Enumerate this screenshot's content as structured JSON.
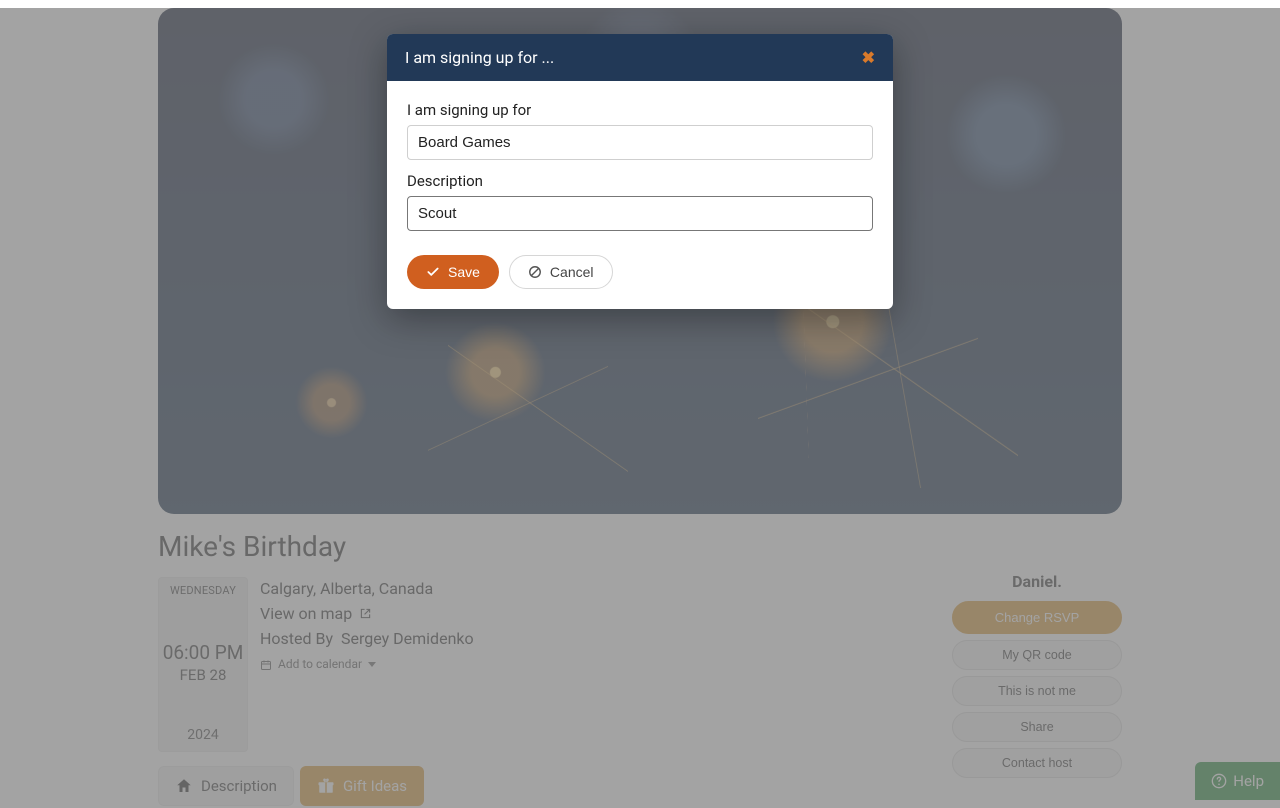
{
  "modal": {
    "title": "I am signing up for ...",
    "field1_label": "I am signing up for",
    "field1_value": "Board Games",
    "field2_label": "Description",
    "field2_value": "Scout",
    "save_label": "Save",
    "cancel_label": "Cancel"
  },
  "event": {
    "title": "Mike's Birthday",
    "weekday": "WEDNESDAY",
    "time": "06:00 PM",
    "monthday": "FEB 28",
    "year": "2024",
    "location": "Calgary, Alberta, Canada",
    "view_on_map": "View on map",
    "hosted_by_label": "Hosted By",
    "host_name": "Sergey Demidenko",
    "add_to_calendar": "Add to calendar"
  },
  "sidebar": {
    "username": "Daniel.",
    "change_rsvp": "Change RSVP",
    "my_qr": "My QR code",
    "not_me": "This is not me",
    "share": "Share",
    "contact_host": "Contact host"
  },
  "tabs": {
    "description": "Description",
    "gift_ideas": "Gift Ideas"
  },
  "help": {
    "label": "Help"
  }
}
